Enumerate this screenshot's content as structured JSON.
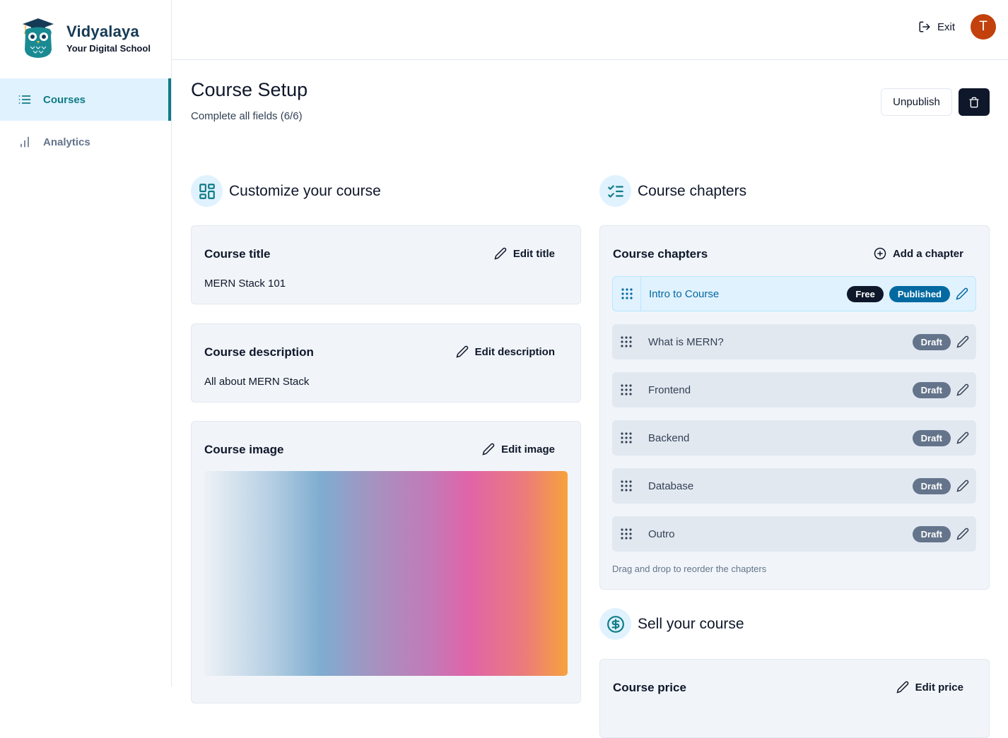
{
  "brand": {
    "name": "Vidyalaya",
    "tagline": "Your Digital School",
    "logo_icon": "owl-graduate-icon"
  },
  "sidebar": {
    "items": [
      {
        "label": "Courses",
        "icon": "list-icon",
        "active": true
      },
      {
        "label": "Analytics",
        "icon": "bar-chart-icon",
        "active": false
      }
    ]
  },
  "topbar": {
    "exit_label": "Exit",
    "avatar_initial": "T",
    "avatar_color": "#c2410c"
  },
  "header": {
    "title": "Course Setup",
    "subtitle": "Complete all fields (6/6)",
    "unpublish_label": "Unpublish"
  },
  "customize": {
    "heading": "Customize your course",
    "title_card": {
      "label": "Course title",
      "action": "Edit title",
      "value": "MERN Stack 101"
    },
    "description_card": {
      "label": "Course description",
      "action": "Edit description",
      "value": "All about MERN Stack"
    },
    "image_card": {
      "label": "Course image",
      "action": "Edit image"
    }
  },
  "chapters": {
    "heading": "Course chapters",
    "card_label": "Course chapters",
    "add_label": "Add a chapter",
    "items": [
      {
        "title": "Intro to Course",
        "free": "Free",
        "status": "Published"
      },
      {
        "title": "What is MERN?",
        "status": "Draft"
      },
      {
        "title": "Frontend",
        "status": "Draft"
      },
      {
        "title": "Backend",
        "status": "Draft"
      },
      {
        "title": "Database",
        "status": "Draft"
      },
      {
        "title": "Outro",
        "status": "Draft"
      }
    ],
    "hint": "Drag and drop to reorder the chapters"
  },
  "sell": {
    "heading": "Sell your course",
    "price_card": {
      "label": "Course price",
      "action": "Edit price"
    }
  },
  "colors": {
    "accent": "#0e7c86",
    "published": "#0369a1",
    "draft": "#64748b",
    "dark": "#0f172a"
  }
}
